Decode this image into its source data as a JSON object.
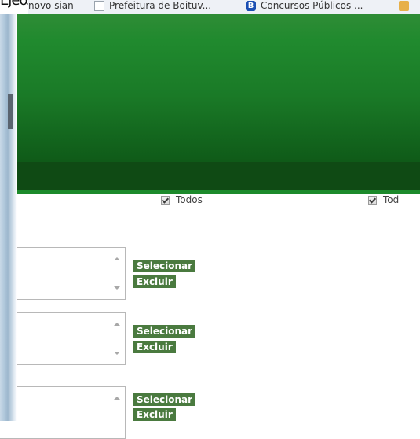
{
  "corner_text": "Ejéos",
  "bookmarks": [
    {
      "label": "novo sian",
      "icon": "none"
    },
    {
      "label": "Prefeitura de Boituv...",
      "icon": "page-icon"
    },
    {
      "label": "Concursos Públicos ...",
      "icon": "blogger-icon"
    }
  ],
  "filters": {
    "todos_1": "Todos",
    "todos_2": "Tod"
  },
  "rows": [
    {
      "select_label": "Selecionar",
      "delete_label": "Excluir"
    },
    {
      "select_label": "Selecionar",
      "delete_label": "Excluir"
    },
    {
      "select_label": "Selecionar",
      "delete_label": "Excluir"
    }
  ],
  "colors": {
    "header_green": "#1a7a27",
    "header_bar": "#0f4a14",
    "button_green": "#4a7a3f"
  }
}
